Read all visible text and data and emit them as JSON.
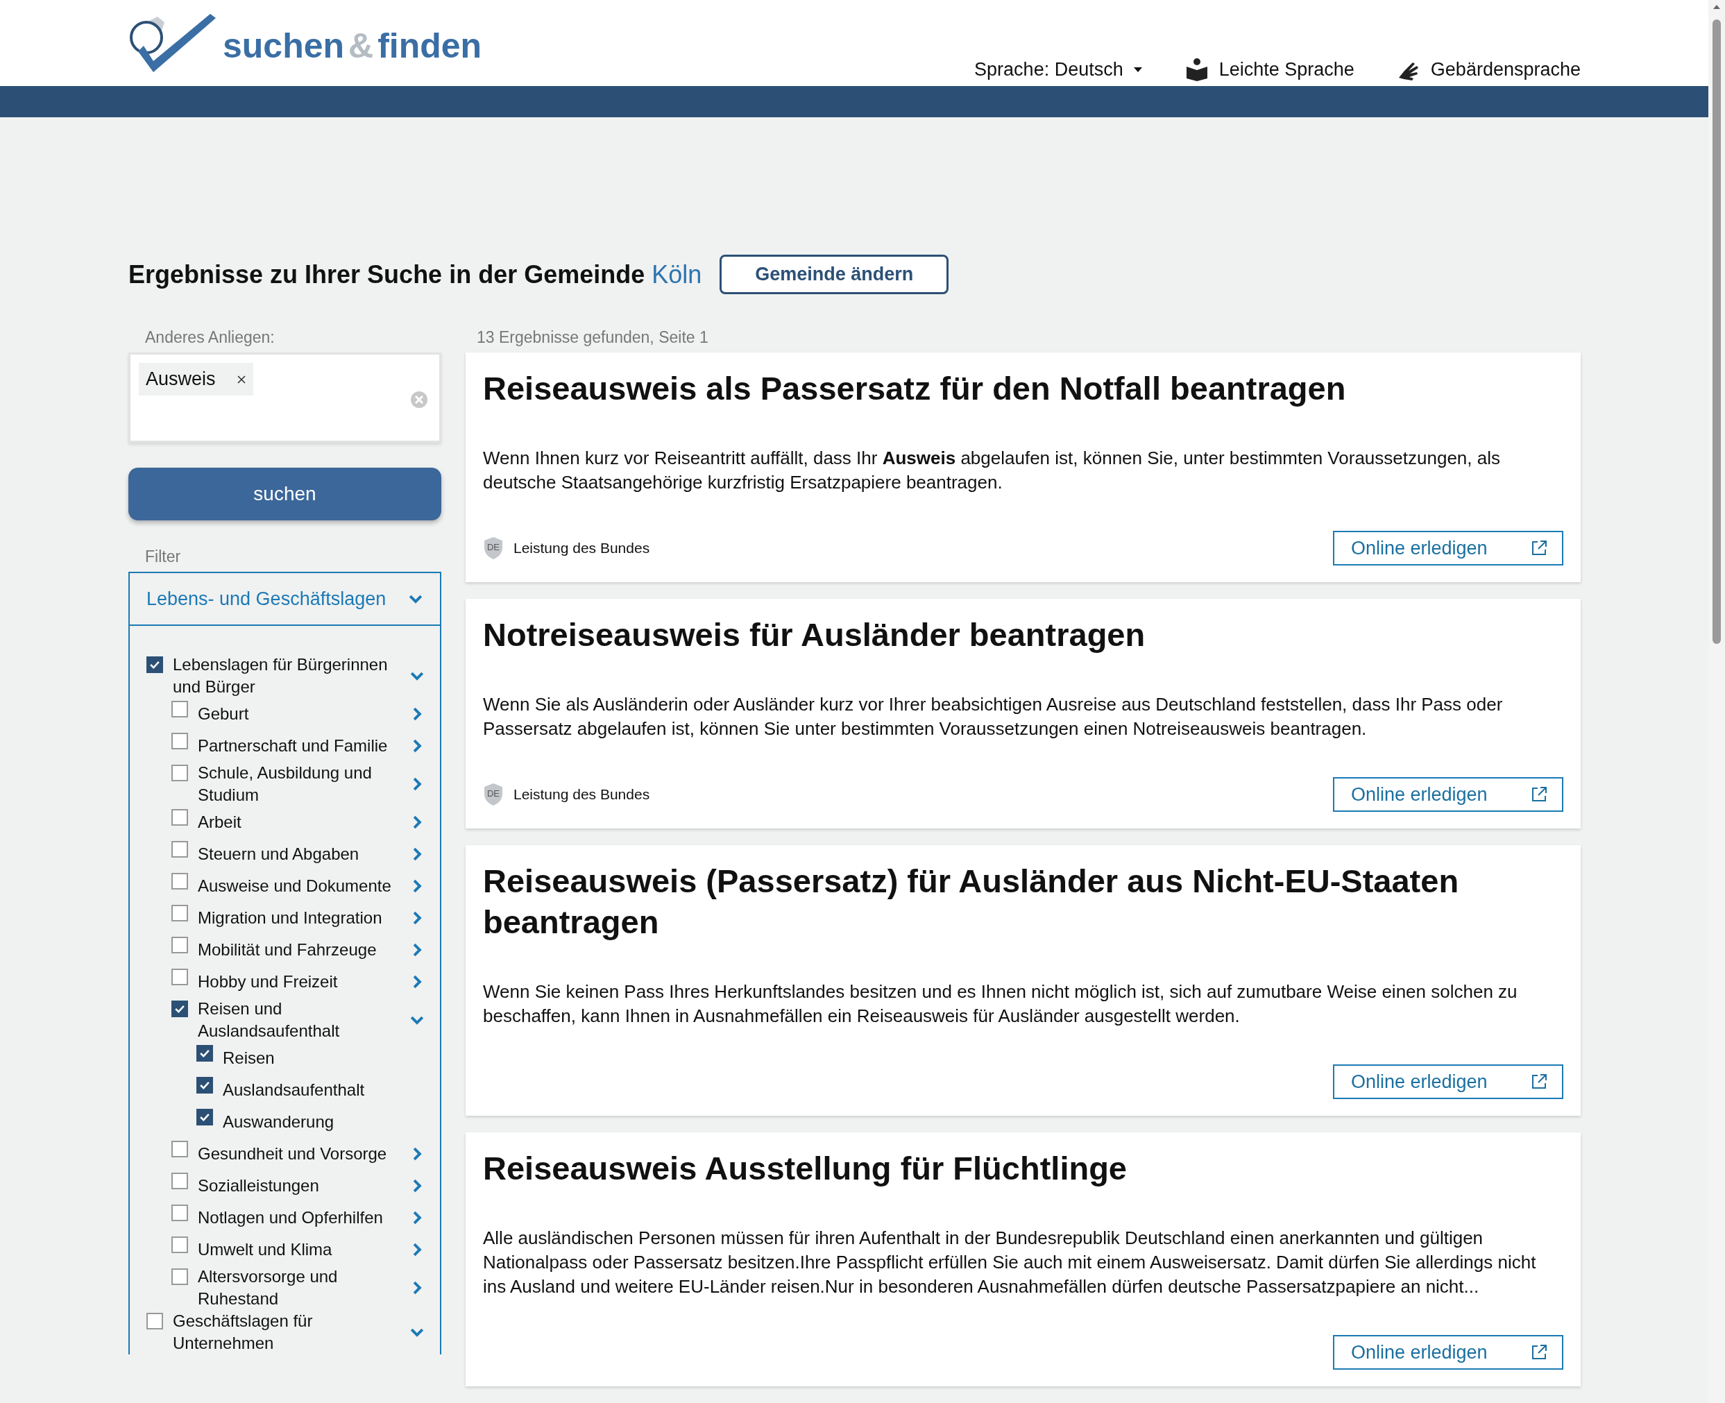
{
  "header": {
    "logo": [
      {
        "text": "suchen",
        "kind": "main"
      },
      {
        "text": "&",
        "kind": "amp"
      },
      {
        "text": "finden",
        "kind": "main"
      }
    ],
    "nav": [
      {
        "label": "Sprache: Deutsch",
        "kind": "dropdown"
      },
      {
        "label": "Leichte Sprache",
        "kind": "easy-language"
      },
      {
        "label": "Gebärdensprache",
        "kind": "sign-language"
      }
    ]
  },
  "heading": {
    "text": "Ergebnisse zu Ihrer Suche in der Gemeinde",
    "place": "Köln",
    "button": "Gemeinde ändern"
  },
  "search": {
    "label": "Anderes Anliegen:",
    "tags": [
      "Ausweis"
    ],
    "button": "suchen"
  },
  "filter": {
    "label": "Filter",
    "section": "Lebens- und Geschäftslagen",
    "expanded": true,
    "items": [
      {
        "label": "Lebenslagen für Bürgerinnen und Bürger",
        "checked": true,
        "expanded": true,
        "children": [
          {
            "label": "Geburt",
            "checked": false,
            "expanded": false
          },
          {
            "label": "Partnerschaft und Familie",
            "checked": false,
            "expanded": false
          },
          {
            "label": "Schule, Ausbildung und Studium",
            "checked": false,
            "expanded": false
          },
          {
            "label": "Arbeit",
            "checked": false,
            "expanded": false
          },
          {
            "label": "Steuern und Abgaben",
            "checked": false,
            "expanded": false
          },
          {
            "label": "Ausweise und Dokumente",
            "checked": false,
            "expanded": false
          },
          {
            "label": "Migration und Integration",
            "checked": false,
            "expanded": false
          },
          {
            "label": "Mobilität und Fahrzeuge",
            "checked": false,
            "expanded": false
          },
          {
            "label": "Hobby und Freizeit",
            "checked": false,
            "expanded": false
          },
          {
            "label": "Reisen und Auslandsaufenthalt",
            "checked": true,
            "expanded": true,
            "children": [
              {
                "label": "Reisen",
                "checked": true
              },
              {
                "label": "Auslandsaufenthalt",
                "checked": true
              },
              {
                "label": "Auswanderung",
                "checked": true
              }
            ]
          },
          {
            "label": "Gesundheit und Vorsorge",
            "checked": false,
            "expanded": false
          },
          {
            "label": "Sozialleistungen",
            "checked": false,
            "expanded": false
          },
          {
            "label": "Notlagen und Opferhilfen",
            "checked": false,
            "expanded": false
          },
          {
            "label": "Umwelt und Klima",
            "checked": false,
            "expanded": false
          },
          {
            "label": "Altersvorsorge und Ruhestand",
            "checked": false,
            "expanded": false
          }
        ]
      },
      {
        "label": "Geschäftslagen für Unternehmen",
        "checked": false,
        "expanded": true
      }
    ]
  },
  "results": {
    "count": "13 Ergebnisse gefunden, Seite 1",
    "items": [
      {
        "title": "Reiseausweis als Passersatz für den Notfall beantragen",
        "description": "Wenn Ihnen kurz vor Reiseantritt auffällt, dass Ihr **Ausweis** abgelaufen ist, können Sie, unter bestimmten Voraussetzungen, als deutsche Staatsangehörige kurzfristig Ersatzpapiere beantragen.",
        "badge": {
          "code": "DE",
          "text": "Leistung des Bundes"
        },
        "button": "Online erledigen"
      },
      {
        "title": "Notreiseausweis für Ausländer beantragen",
        "description": "Wenn Sie als Ausländerin oder Ausländer kurz vor Ihrer beabsichtigen Ausreise aus Deutschland feststellen, dass Ihr Pass oder Passersatz abgelaufen ist, können Sie unter bestimmten Voraussetzungen einen Notreiseausweis beantragen.",
        "badge": {
          "code": "DE",
          "text": "Leistung des Bundes"
        },
        "button": "Online erledigen"
      },
      {
        "title": "Reiseausweis (Passersatz) für Ausländer aus Nicht-EU-Staaten beantragen",
        "description": "Wenn Sie keinen Pass Ihres Herkunftslandes besitzen und es Ihnen nicht möglich ist, sich auf zumutbare Weise einen solchen zu beschaffen, kann Ihnen in Ausnahmefällen ein Reiseausweis für Ausländer ausgestellt werden.",
        "button": "Online erledigen"
      },
      {
        "title": "Reiseausweis Ausstellung für Flüchtlinge",
        "description": "Alle ausländischen Personen müssen für ihren Aufenthalt in der Bundesrepublik Deutschland einen anerkannten und gültigen Nationalpass oder Passersatz besitzen.Ihre Passpflicht erfüllen Sie auch mit einem Ausweisersatz. Damit dürfen Sie allerdings nicht ins Ausland und weitere EU-Länder reisen.Nur in besonderen Ausnahmefällen dürfen deutsche Passersatzpapiere an nicht...",
        "button": "Online erledigen"
      }
    ]
  }
}
